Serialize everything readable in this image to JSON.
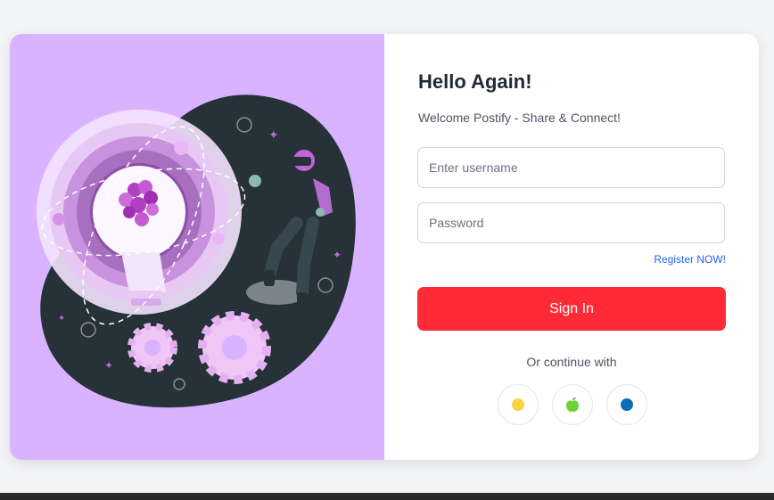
{
  "form": {
    "title": "Hello Again!",
    "subtitle": "Welcome Postify - Share & Connect!",
    "username_placeholder": "Enter username",
    "password_placeholder": "Password",
    "register_link": "Register NOW!",
    "signin_label": "Sign In",
    "continue_with": "Or continue with"
  },
  "social_buttons": [
    {
      "icon": "yellow-circle-icon",
      "color": "#f9d342"
    },
    {
      "icon": "green-apple-icon",
      "color": "#6fd13a"
    },
    {
      "icon": "blue-circle-icon",
      "color": "#0b6cb8"
    }
  ],
  "colors": {
    "illustration_background": "#d9b3ff",
    "primary_button": "#ff2a35",
    "link": "#2563eb"
  }
}
